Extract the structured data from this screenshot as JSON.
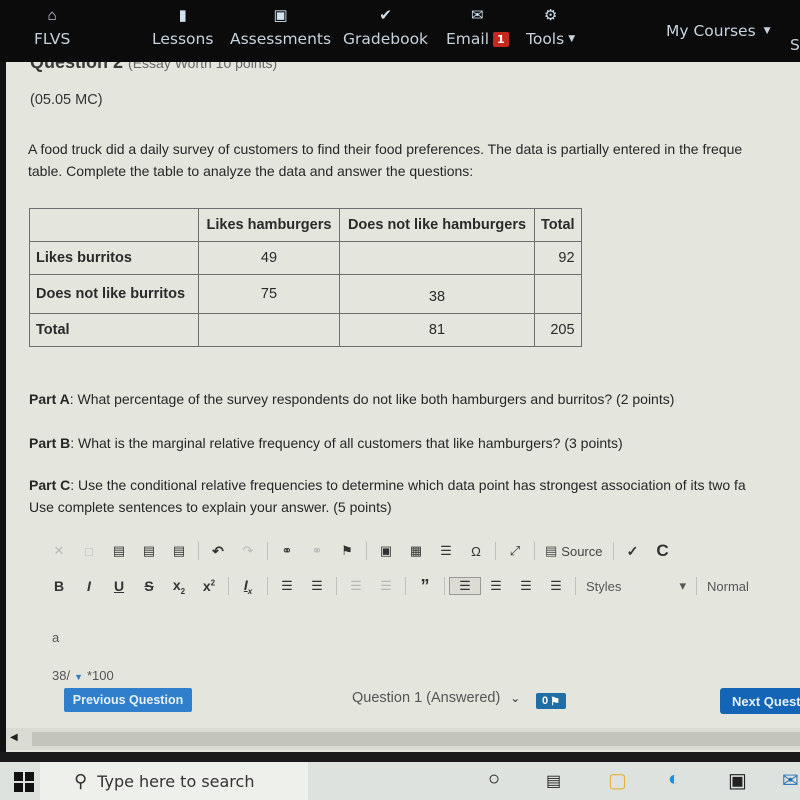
{
  "nav": {
    "items": [
      {
        "label": "FLVS",
        "icon": "home-icon"
      },
      {
        "label": "Lessons",
        "icon": "book-icon"
      },
      {
        "label": "Assessments",
        "icon": "inbox-icon"
      },
      {
        "label": "Gradebook",
        "icon": "checkmark-icon"
      },
      {
        "label": "Email",
        "icon": "envelope-icon",
        "badge": "1"
      },
      {
        "label": "Tools",
        "icon": "gear-icon"
      }
    ],
    "my_courses": "My Courses",
    "cut_item": "S"
  },
  "question": {
    "title": "Question 2",
    "worth": "(Essay Worth 10 points)",
    "code": "(05.05 MC)",
    "intro_line1": "A food truck did a daily survey of customers to find their food preferences. The data is partially entered in the freque",
    "intro_line2": "table. Complete the table to analyze the data and answer the questions:"
  },
  "table": {
    "headers": [
      "",
      "Likes hamburgers",
      "Does not like hamburgers",
      "Total"
    ],
    "rows": [
      [
        "Likes burritos",
        "49",
        "",
        "92"
      ],
      [
        "Does not like burritos",
        "75",
        "38",
        ""
      ],
      [
        "Total",
        "",
        "81",
        "205"
      ]
    ]
  },
  "parts": {
    "a_label": "Part A",
    "a_text": ": What percentage of the survey respondents do not like both hamburgers and burritos? (2 points)",
    "b_label": "Part B",
    "b_text": ": What is the marginal relative frequency of all customers that like hamburgers? (3 points)",
    "c_label": "Part C",
    "c_text": ": Use the conditional relative frequencies to determine which data point has strongest association of its two fa",
    "c_text2": "Use complete sentences to explain your answer. (5 points)"
  },
  "editor": {
    "source_label": "Source",
    "styles_label": "Styles",
    "format_label": "Normal",
    "help_label": "?",
    "content_line1": "a",
    "content_line2a": "38/",
    "content_line2b": "*100"
  },
  "footer": {
    "prev_label": "Previous Question",
    "question_select": "Question 1 (Answered)",
    "flag_count": "0",
    "next_label": "Next Questi"
  },
  "taskbar": {
    "search_placeholder": "Type here to search"
  }
}
